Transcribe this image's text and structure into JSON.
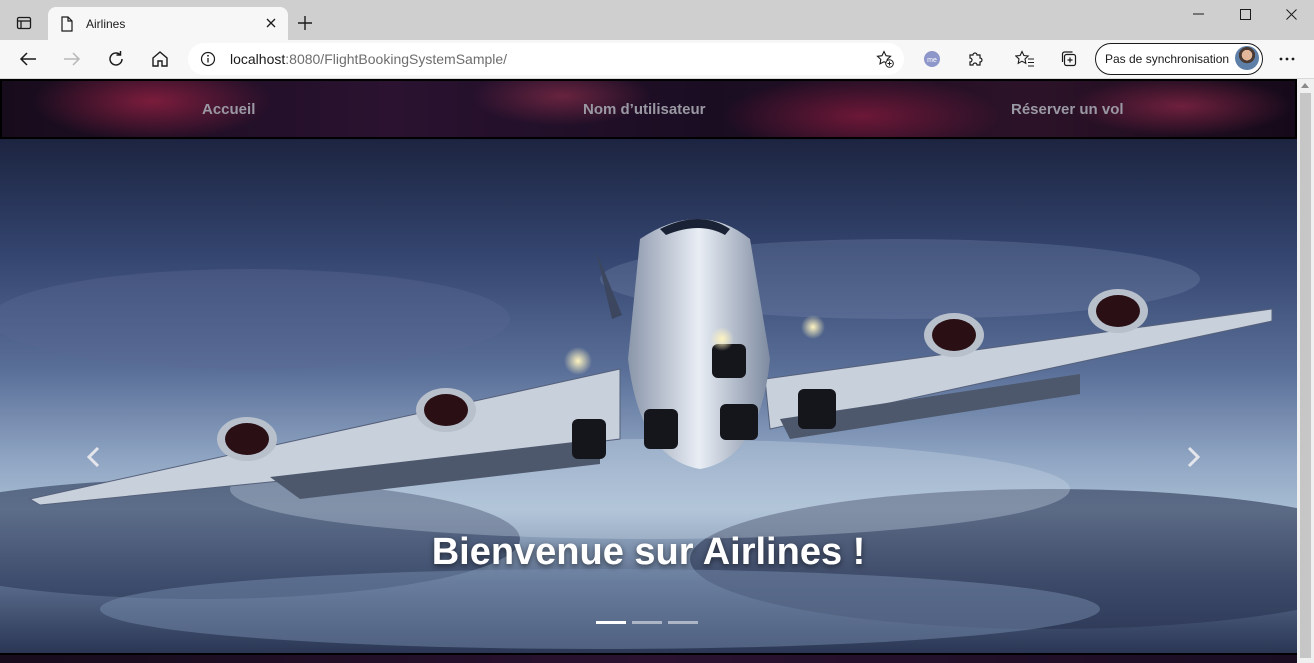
{
  "browser": {
    "tab_title": "Airlines",
    "url_host": "localhost",
    "url_rest": ":8080/FlightBookingSystemSample/",
    "sync_label": "Pas de synchronisation",
    "extension_badge": "me"
  },
  "nav": {
    "home": "Accueil",
    "username": "Nom d’utilisateur",
    "book": "Réserver un vol"
  },
  "carousel": {
    "caption": "Bienvenue sur Airlines !",
    "slide_count": 3,
    "active_slide": 1
  }
}
